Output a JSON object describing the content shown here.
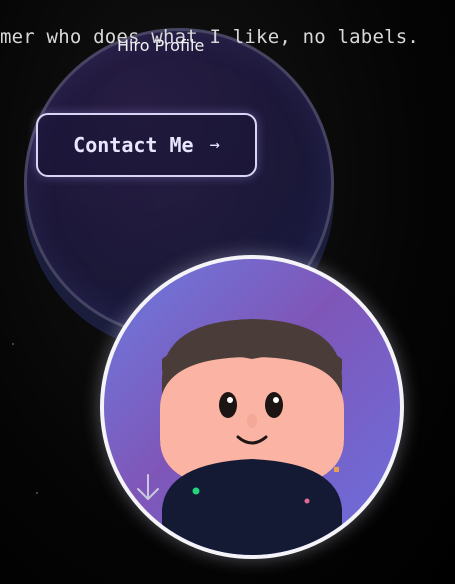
{
  "tagline": "mer who does what I like, no labels.",
  "profile": {
    "title": "Hiro Profile"
  },
  "contact": {
    "label": "Contact Me",
    "arrow": "→"
  },
  "icons": {
    "arrow": "arrow-right-icon",
    "scroll": "arrow-down-icon"
  },
  "colors": {
    "accent": "#d9d6f5",
    "avatar_gradient_start": "#6c7ce0",
    "avatar_gradient_mid": "#7f56b8",
    "skin": "#fbb3a3",
    "hair": "#4a3c38",
    "shirt": "#141a34"
  }
}
